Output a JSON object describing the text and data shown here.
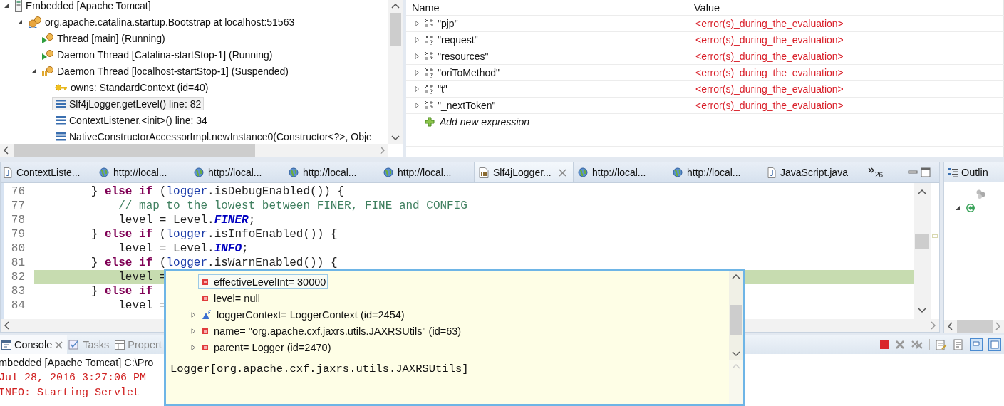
{
  "debug_tree": {
    "items": [
      {
        "label": "Embedded [Apache Tomcat]",
        "kind": "launch",
        "expanded": true,
        "selected": false,
        "children": [
          {
            "label": "org.apache.catalina.startup.Bootstrap at localhost:51563",
            "kind": "process",
            "expanded": true,
            "selected": false,
            "children": [
              {
                "label": "Thread [main] (Running)",
                "kind": "thread_running",
                "selected": false
              },
              {
                "label": "Daemon Thread [Catalina-startStop-1] (Running)",
                "kind": "thread_running",
                "selected": false
              },
              {
                "label": "Daemon Thread [localhost-startStop-1] (Suspended)",
                "kind": "thread_suspended",
                "expanded": true,
                "selected": false,
                "children": [
                  {
                    "label": "owns: StandardContext  (id=40)",
                    "kind": "monitor",
                    "selected": false
                  },
                  {
                    "label": "Slf4jLogger.getLevel() line: 82",
                    "kind": "frame",
                    "selected": true
                  },
                  {
                    "label": "ContextListener.<init>() line: 34",
                    "kind": "frame",
                    "selected": false
                  },
                  {
                    "label": "NativeConstructorAccessorImpl.newInstance0(Constructor<?>, Obje",
                    "kind": "frame",
                    "selected": false
                  }
                ]
              }
            ]
          }
        ]
      }
    ]
  },
  "expressions": {
    "columns": [
      "Name",
      "Value"
    ],
    "rows": [
      {
        "name": "\"pjp\"",
        "value": "<error(s)_during_the_evaluation>",
        "expanded": false
      },
      {
        "name": "\"request\"",
        "value": "<error(s)_during_the_evaluation>",
        "expanded": false
      },
      {
        "name": "\"resources\"",
        "value": "<error(s)_during_the_evaluation>",
        "expanded": false
      },
      {
        "name": "\"oriToMethod\"",
        "value": "<error(s)_during_the_evaluation>",
        "expanded": false
      },
      {
        "name": "\"t\"",
        "value": "<error(s)_during_the_evaluation>",
        "expanded": false
      },
      {
        "name": "\"_nextToken\"",
        "value": "<error(s)_during_the_evaluation>",
        "expanded": false
      }
    ],
    "add_label": "Add new expression"
  },
  "editor": {
    "tabs": [
      {
        "label": "ContextListe...",
        "kind": "java",
        "selected": false
      },
      {
        "label": "http://local...",
        "kind": "web",
        "selected": false
      },
      {
        "label": "http://local...",
        "kind": "web",
        "selected": false
      },
      {
        "label": "http://local...",
        "kind": "web",
        "selected": false
      },
      {
        "label": "http://local...",
        "kind": "web",
        "selected": false
      },
      {
        "label": "Slf4jLogger...",
        "kind": "class",
        "selected": true
      },
      {
        "label": "http://local...",
        "kind": "web",
        "selected": false
      },
      {
        "label": "http://local...",
        "kind": "web",
        "selected": false
      },
      {
        "label": "JavaScript.java",
        "kind": "java",
        "selected": false
      }
    ],
    "overflow_count": "26",
    "lines": [
      {
        "number": "76",
        "current": false,
        "tokens": [
          {
            "kind": "plain",
            "text": "        } "
          },
          {
            "kind": "keyword",
            "text": "else if"
          },
          {
            "kind": "plain",
            "text": " ("
          },
          {
            "kind": "field",
            "text": "logger"
          },
          {
            "kind": "plain",
            "text": ".isDebugEnabled()) {"
          }
        ]
      },
      {
        "number": "77",
        "current": false,
        "tokens": [
          {
            "kind": "comment",
            "text": "            // map to the lowest between FINER, FINE and CONFIG"
          }
        ]
      },
      {
        "number": "78",
        "current": false,
        "tokens": [
          {
            "kind": "plain",
            "text": "            level = Level."
          },
          {
            "kind": "constant",
            "text": "FINER"
          },
          {
            "kind": "plain",
            "text": ";"
          }
        ]
      },
      {
        "number": "79",
        "current": false,
        "tokens": [
          {
            "kind": "plain",
            "text": "        } "
          },
          {
            "kind": "keyword",
            "text": "else if"
          },
          {
            "kind": "plain",
            "text": " ("
          },
          {
            "kind": "field",
            "text": "logger"
          },
          {
            "kind": "plain",
            "text": ".isInfoEnabled()) {"
          }
        ]
      },
      {
        "number": "80",
        "current": false,
        "tokens": [
          {
            "kind": "plain",
            "text": "            level = Level."
          },
          {
            "kind": "constant",
            "text": "INFO"
          },
          {
            "kind": "plain",
            "text": ";"
          }
        ]
      },
      {
        "number": "81",
        "current": false,
        "tokens": [
          {
            "kind": "plain",
            "text": "        } "
          },
          {
            "kind": "keyword",
            "text": "else if"
          },
          {
            "kind": "plain",
            "text": " ("
          },
          {
            "kind": "field",
            "text": "logger"
          },
          {
            "kind": "plain",
            "text": ".isWarnEnabled()) {"
          }
        ]
      },
      {
        "number": "82",
        "current": true,
        "tokens": [
          {
            "kind": "plain",
            "text": "            level ="
          }
        ]
      },
      {
        "number": "83",
        "current": false,
        "tokens": [
          {
            "kind": "plain",
            "text": "        } "
          },
          {
            "kind": "keyword",
            "text": "else if"
          }
        ]
      },
      {
        "number": "84",
        "current": false,
        "tokens": [
          {
            "kind": "plain",
            "text": "            level ="
          }
        ]
      }
    ]
  },
  "outline": {
    "title": "Outlin"
  },
  "console": {
    "tabs": [
      {
        "label": "Console",
        "kind": "console",
        "selected": true
      },
      {
        "label": "Tasks",
        "kind": "tasks",
        "selected": false
      },
      {
        "label": "Propert",
        "kind": "properties",
        "selected": false
      }
    ],
    "lines": [
      {
        "kind": "header",
        "text": "mbedded [Apache Tomcat] C:\\Pro"
      },
      {
        "kind": "error",
        "text": "Jul 28, 2016 3:27:06 PM"
      },
      {
        "kind": "error",
        "text": "INFO: Starting Servlet"
      }
    ]
  },
  "hover": {
    "items": [
      {
        "label": "effectiveLevelInt= 30000",
        "kind": "field",
        "selected": true
      },
      {
        "label": "level= null",
        "kind": "field",
        "selected": false
      },
      {
        "label": "loggerContext= LoggerContext  (id=2454)",
        "kind": "final_field",
        "expanded": false,
        "selected": false
      },
      {
        "label": "name= \"org.apache.cxf.jaxrs.utils.JAXRSUtils\" (id=63)",
        "kind": "field",
        "expanded": false,
        "selected": false
      },
      {
        "label": "parent= Logger  (id=2470)",
        "kind": "field",
        "expanded": false,
        "selected": false
      }
    ],
    "detail": "Logger[org.apache.cxf.jaxrs.utils.JAXRSUtils]"
  }
}
